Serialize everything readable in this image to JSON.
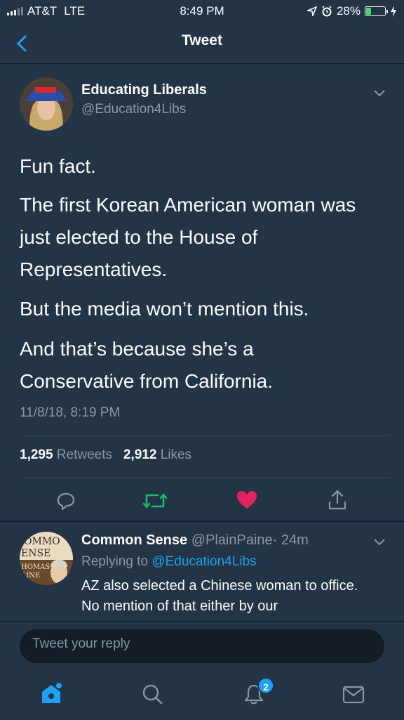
{
  "status_bar": {
    "carrier": "AT&T",
    "network": "LTE",
    "time": "8:49 PM",
    "battery": "28%",
    "battery_level": 0.28
  },
  "nav": {
    "title": "Tweet",
    "back_icon": "chevron-left-icon"
  },
  "tweet": {
    "display_name": "Educating Liberals",
    "handle": "@Education4Libs",
    "paragraphs": [
      "Fun fact.",
      "The first Korean American woman was just elected to the House of Representatives.",
      "But the media won’t mention this.",
      "And that’s because she’s a Conservative from California."
    ],
    "timestamp": "11/8/18, 8:19 PM",
    "retweets_count": "1,295",
    "retweets_label": "Retweets",
    "likes_count": "2,912",
    "likes_label": "Likes",
    "liked": true
  },
  "reply": {
    "display_name": "Common Sense",
    "handle": "@PlainPaine",
    "age": "· 24m",
    "replying_prefix": "Replying to",
    "replying_to": "@Education4Libs",
    "text": "AZ also selected a Chinese woman to office.  No mention of that either by our",
    "avatar_text": [
      "OMMO",
      "ENSE",
      "HOMAS",
      "AINE"
    ]
  },
  "compose": {
    "placeholder": "Tweet your reply"
  },
  "tabbar": {
    "notifications_badge": "2"
  },
  "colors": {
    "background": "#243447",
    "accent": "#1da1f2",
    "muted": "#8899a6",
    "like": "#e0245e",
    "retweet": "#17bf63"
  }
}
